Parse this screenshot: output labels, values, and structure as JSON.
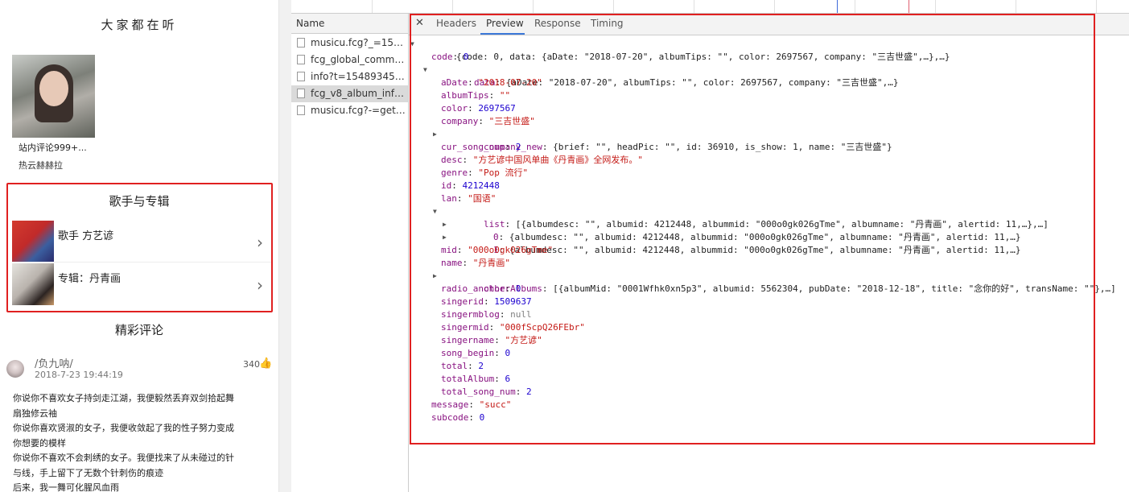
{
  "left": {
    "listen_title": "大家都在听",
    "recommend": {
      "title": "站内评论999+...",
      "subtitle": "热云赫赫拉"
    },
    "singer_section": {
      "title": "歌手与专辑",
      "singer_label": "歌手 方艺谚",
      "album_label": "专辑：丹青画"
    },
    "comments_title": "精彩评论",
    "comment": {
      "user": "/负九呐/",
      "time": "2018-7-23 19:44:19",
      "likes": "340",
      "lines": [
        "你说你不喜欢女子持剑走江湖，我便毅然丢弃双剑拾起舞",
        "扇独修云袖",
        " 你说你喜欢贤淑的女子，我便收敛起了我的性子努力变成",
        "你想要的模样",
        "你说你不喜欢不会刺绣的女子。我便找来了从未碰过的针",
        "与线，手上留下了无数个针刺伤的痕迹",
        " 后来，我一舞可化腥风血雨"
      ]
    }
  },
  "devtools": {
    "name_header": "Name",
    "requests": [
      "musicu.fcg?_=15489...",
      "fcg_global_commen...",
      "info?t=1548934502...",
      "fcg_v8_album_info_c...",
      "musicu.fcg?-=getpl..."
    ],
    "tabs": [
      "Headers",
      "Preview",
      "Response",
      "Timing"
    ],
    "json_root": "{code: 0, data: {aDate: \"2018-07-20\", albumTips: \"\", color: 2697567, company: \"三吉世盛\",…},…}",
    "code": "0",
    "data_summary": "{aDate: \"2018-07-20\", albumTips: \"\", color: 2697567, company: \"三吉世盛\",…}",
    "aDate": "\"2018-07-20\"",
    "albumTips": "\"\"",
    "color": "2697567",
    "company": "\"三吉世盛\"",
    "company_new": "{brief: \"\", headPic: \"\", id: 36910, is_show: 1, name: \"三吉世盛\"}",
    "cur_song_num": "2",
    "desc": "\"方艺谚中国风单曲《丹青画》全网发布。\"",
    "genre": "\"Pop 流行\"",
    "id": "4212448",
    "lan": "\"国语\"",
    "list": "[{albumdesc: \"\", albumid: 4212448, albummid: \"000o0gk026gTme\", albumname: \"丹青画\", alertid: 11,…},…]",
    "list_0": "{albumdesc: \"\", albumid: 4212448, albummid: \"000o0gk026gTme\", albumname: \"丹青画\", alertid: 11,…}",
    "list_1": "{albumdesc: \"\", albumid: 4212448, albummid: \"000o0gk026gTme\", albumname: \"丹青画\", alertid: 11,…}",
    "mid": "\"000o0gk026gTme\"",
    "name": "\"丹青画\"",
    "otherAlbums": "[{albumMid: \"0001Wfhk0xn5p3\", albumid: 5562304, pubDate: \"2018-12-18\", title: \"念你的好\", transName: \"\"},…]",
    "radio_anchor": "0",
    "singerid": "1509637",
    "singermblog": "null",
    "singermid": "\"000fScpQ26FEbr\"",
    "singername": "\"方艺谚\"",
    "song_begin": "0",
    "total": "2",
    "totalAlbum": "6",
    "total_song_num": "2",
    "message": "\"succ\"",
    "subcode": "0"
  }
}
